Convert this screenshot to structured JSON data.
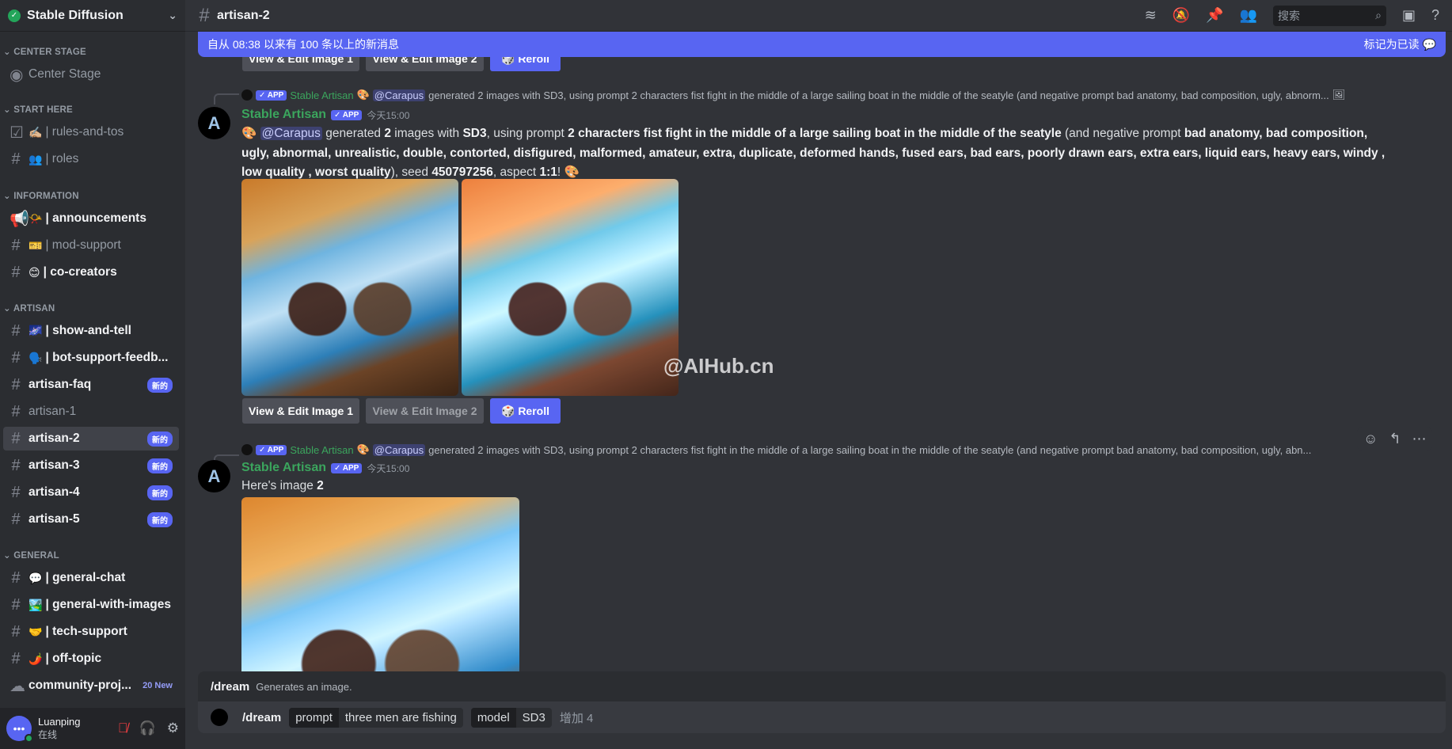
{
  "server": {
    "name": "Stable Diffusion"
  },
  "sidebar": {
    "categories": [
      "CENTER STAGE",
      "START HERE",
      "INFORMATION",
      "ARTISAN",
      "GENERAL"
    ],
    "channels": [
      {
        "label": "Center Stage",
        "icon": "stage-icon"
      },
      {
        "label": "rules-and-tos",
        "emoji": "✍🏼",
        "icon": "rules-icon"
      },
      {
        "label": "roles",
        "emoji": "👥"
      },
      {
        "label": "announcements",
        "emoji": "📯",
        "icon": "megaphone-icon"
      },
      {
        "label": "mod-support",
        "emoji": "🎫"
      },
      {
        "label": "co-creators",
        "emoji": "😊"
      },
      {
        "label": "show-and-tell",
        "emoji": "🌌"
      },
      {
        "label": "bot-support-feedb...",
        "emoji": "🗣️"
      },
      {
        "label": "artisan-faq",
        "badge": "新的"
      },
      {
        "label": "artisan-1"
      },
      {
        "label": "artisan-2",
        "badge": "新的"
      },
      {
        "label": "artisan-3",
        "badge": "新的"
      },
      {
        "label": "artisan-4",
        "badge": "新的"
      },
      {
        "label": "artisan-5",
        "badge": "新的"
      },
      {
        "label": "general-chat",
        "emoji": "💬"
      },
      {
        "label": "general-with-images",
        "emoji": "🏞️"
      },
      {
        "label": "tech-support",
        "emoji": "🤝"
      },
      {
        "label": "off-topic",
        "emoji": "🌶️"
      },
      {
        "label": "community-proj...",
        "badge": "20 New"
      }
    ]
  },
  "user": {
    "name": "Luanping",
    "status": "在线"
  },
  "topbar": {
    "channel": "artisan-2",
    "search_placeholder": "搜索"
  },
  "banner": {
    "text": "自从 08:38 以来有 100 条以上的新消息",
    "mark_read": "标记为已读"
  },
  "buttons": {
    "view1": "View & Edit Image 1",
    "view2": "View & Edit Image 2",
    "reroll": "🎲 Reroll"
  },
  "messages": [
    {
      "reply": {
        "app": "✓ APP",
        "author": "Stable Artisan",
        "mention": "@Carapus",
        "text": "generated 2 images with SD3, using prompt 2 characters fist fight in the middle of a large sailing boat in the middle of the seatyle (and negative prompt bad anatomy, bad composition, ugly, abnorm..."
      },
      "author": "Stable Artisan",
      "app": "✓ APP",
      "time": "今天15:00",
      "mention": "@Carapus",
      "t1": " generated ",
      "n": "2",
      "t2": " images with ",
      "model": "SD3",
      "t3": ", using prompt ",
      "prompt": "2 characters fist fight in the middle of a large sailing boat in the middle of the seatyle",
      "t4": " (and negative prompt ",
      "negative": "bad anatomy, bad composition, ugly, abnormal, unrealistic, double, contorted, disfigured, malformed, amateur, extra, duplicate, deformed hands, fused ears, bad ears, poorly drawn ears, extra ears, liquid ears, heavy ears, windy , low quality , worst quality",
      "t5": "), seed ",
      "seed": "450797256",
      "t6": ", aspect ",
      "aspect": "1:1",
      "t7": "!"
    },
    {
      "reply": {
        "app": "✓ APP",
        "author": "Stable Artisan",
        "mention": "@Carapus",
        "text": "generated 2 images with SD3, using prompt 2 characters fist fight in the middle of a large sailing boat in the middle of the seatyle (and negative prompt bad anatomy, bad composition, ugly, abn..."
      },
      "author": "Stable Artisan",
      "app": "✓ APP",
      "time": "今天15:00",
      "t1": "Here's image ",
      "n": "2"
    }
  ],
  "watermark": "@AIHub.cn",
  "autocomplete": {
    "command": "/dream",
    "desc": "Generates an image."
  },
  "composer": {
    "command": "/dream",
    "opt1_key": "prompt",
    "opt1_val": "three men are fishing",
    "opt2_key": "model",
    "opt2_val": "SD3",
    "more": "增加 4"
  }
}
